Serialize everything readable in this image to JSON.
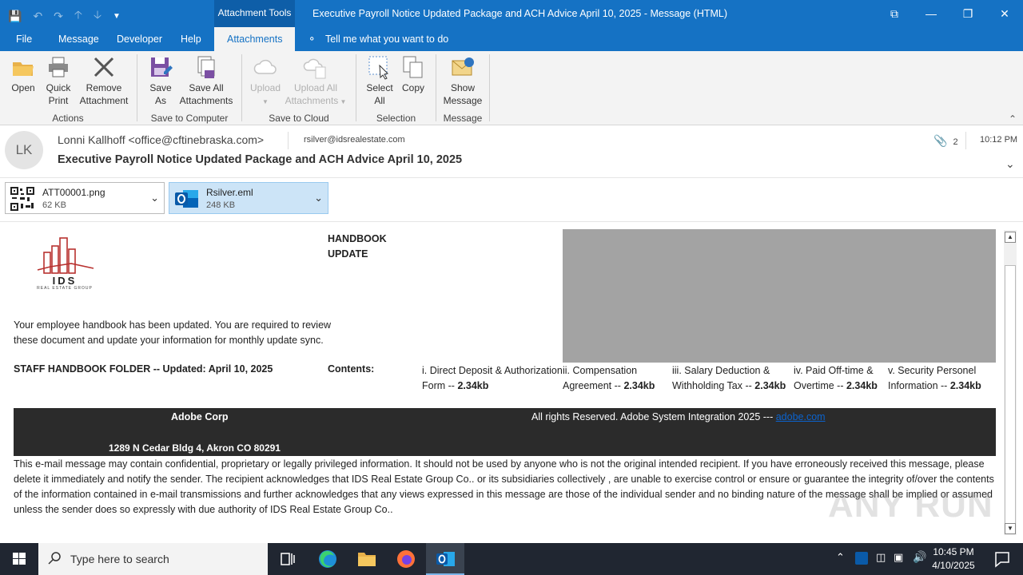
{
  "window": {
    "tools_label": "Attachment Tools",
    "title": "Executive Payroll Notice  Updated Package and ACH Advice  April 10, 2025  -  Message (HTML)"
  },
  "tabs": {
    "file": "File",
    "message": "Message",
    "developer": "Developer",
    "help": "Help",
    "attachments": "Attachments",
    "tell_me": "Tell me what you want to do"
  },
  "ribbon": {
    "open": "Open",
    "quick_print": [
      "Quick",
      "Print"
    ],
    "remove_attachment": [
      "Remove",
      "Attachment"
    ],
    "group_actions": "Actions",
    "save_as": [
      "Save",
      "As"
    ],
    "save_all": [
      "Save All",
      "Attachments"
    ],
    "group_save_computer": "Save to Computer",
    "upload": "Upload",
    "upload_all": [
      "Upload All",
      "Attachments"
    ],
    "group_save_cloud": "Save to Cloud",
    "select_all": [
      "Select",
      "All"
    ],
    "copy": "Copy",
    "group_selection": "Selection",
    "show_message": [
      "Show",
      "Message"
    ],
    "group_message": "Message"
  },
  "header": {
    "avatar_initials": "LK",
    "from": "Lonni Kallhoff <office@cftinebraska.com>",
    "to": "rsilver@idsrealestate.com",
    "attachment_count": "2",
    "time": "10:12 PM",
    "subject": "Executive Payroll Notice  Updated Package and ACH Advice  April 10, 2025"
  },
  "attachments": [
    {
      "name": "ATT00001.png",
      "size": "62 KB"
    },
    {
      "name": "Rsilver.eml",
      "size": "248 KB"
    }
  ],
  "body": {
    "logo_text": "IDS",
    "logo_sub": "REAL ESTATE GROUP",
    "handbook_line1": "HANDBOOK",
    "handbook_line2": "UPDATE",
    "intro": "Your employee handbook has been updated. You are required to review these document and update your information for monthly update sync.",
    "folder": "STAFF HANDBOOK FOLDER -- Updated: April 10, 2025",
    "contents_label": "Contents:",
    "items": [
      {
        "text": "i. Direct Deposit & Authorization Form --",
        "size": "2.34kb"
      },
      {
        "text": "ii. Compensation Agreement --",
        "size": "2.34kb"
      },
      {
        "text": "iii. Salary Deduction & Withholding Tax --",
        "size": "2.34kb"
      },
      {
        "text": "iv. Paid Off-time & Overtime --",
        "size": "2.34kb"
      },
      {
        "text": "v. Security Personel Information --",
        "size": "2.34kb"
      }
    ],
    "footer_corp": "Adobe Corp",
    "footer_address": "1289  N Cedar Bldg 4, Akron CO 80291",
    "footer_rights": "All rights Reserved. Adobe System Integration 2025 --- ",
    "footer_link": "adobe.com",
    "disclaimer": "This e-mail message may contain confidential, proprietary or legally privileged information. It should not be used by anyone who is not the original intended recipient. If you have erroneously received this message, please delete it immediately and notify the sender. The recipient acknowledges that IDS Real Estate Group Co.. or its subsidiaries collectively , are unable to exercise control or ensure or guarantee the integrity of/over the contents of the information contained in e-mail transmissions and further acknowledges that any views expressed in this message are those of the individual sender and no binding nature of the message shall be implied or assumed unless the sender does so expressly with due authority of IDS Real Estate Group Co.."
  },
  "watermark": "ANY RUN",
  "taskbar": {
    "search_placeholder": "Type here to search",
    "time": "10:45 PM",
    "date": "4/10/2025"
  },
  "colors": {
    "accent": "#1572c4",
    "footer_bg": "#2b2b2b",
    "selected_attachment": "#cce4f7",
    "taskbar": "#202631"
  }
}
